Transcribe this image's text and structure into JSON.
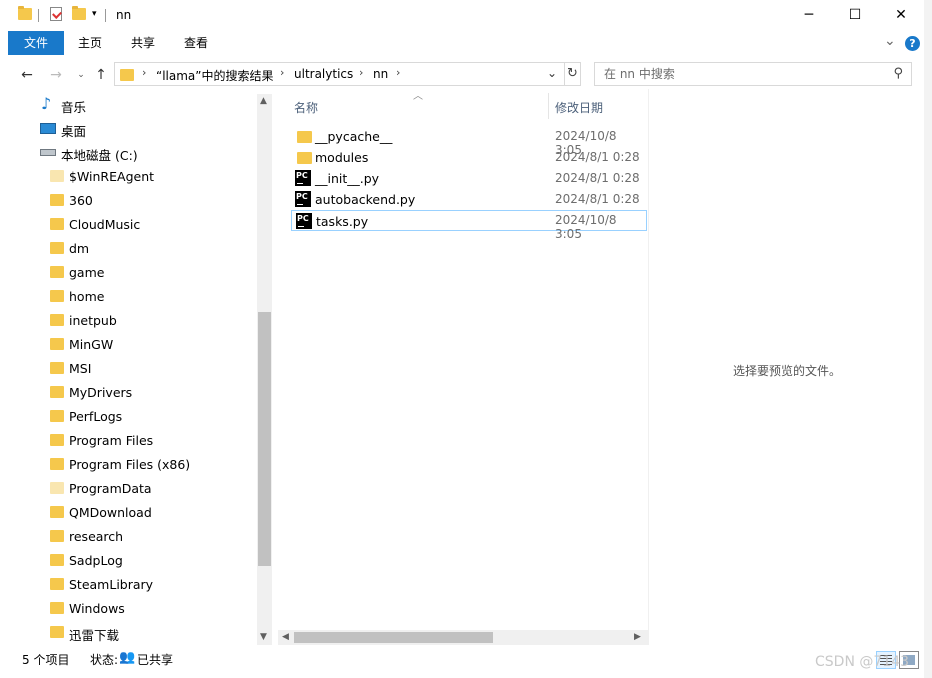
{
  "window": {
    "title": "nn",
    "minimize": "─",
    "maximize": "☐",
    "close": "✕"
  },
  "ribbon": {
    "tabs": [
      {
        "label": "文件"
      },
      {
        "label": "主页"
      },
      {
        "label": "共享"
      },
      {
        "label": "查看"
      }
    ],
    "expand": "⌄",
    "help": "?"
  },
  "address": {
    "crumbs": [
      "“llama”中的搜索结果",
      "ultralytics",
      "nn"
    ],
    "search_placeholder": "在 nn 中搜索"
  },
  "nav": {
    "items": [
      {
        "label": "音乐",
        "icon": "music-icon"
      },
      {
        "label": "桌面",
        "icon": "desktop-icon"
      },
      {
        "label": "本地磁盘 (C:)",
        "icon": "drive-icon"
      },
      {
        "label": "$WinREAgent",
        "icon": "folder-icon"
      },
      {
        "label": "360",
        "icon": "folder-icon"
      },
      {
        "label": "CloudMusic",
        "icon": "folder-icon"
      },
      {
        "label": "dm",
        "icon": "folder-icon"
      },
      {
        "label": "game",
        "icon": "folder-icon"
      },
      {
        "label": "home",
        "icon": "folder-icon"
      },
      {
        "label": "inetpub",
        "icon": "folder-icon"
      },
      {
        "label": "MinGW",
        "icon": "folder-icon"
      },
      {
        "label": "MSI",
        "icon": "folder-icon"
      },
      {
        "label": "MyDrivers",
        "icon": "folder-icon"
      },
      {
        "label": "PerfLogs",
        "icon": "folder-icon"
      },
      {
        "label": "Program Files",
        "icon": "folder-icon"
      },
      {
        "label": "Program Files (x86)",
        "icon": "folder-icon"
      },
      {
        "label": "ProgramData",
        "icon": "folder-icon"
      },
      {
        "label": "QMDownload",
        "icon": "folder-icon"
      },
      {
        "label": "research",
        "icon": "folder-icon"
      },
      {
        "label": "SadpLog",
        "icon": "folder-icon"
      },
      {
        "label": "SteamLibrary",
        "icon": "folder-icon"
      },
      {
        "label": "Windows",
        "icon": "folder-icon"
      },
      {
        "label": "迅雷下载",
        "icon": "folder-icon"
      }
    ]
  },
  "files": {
    "columns": {
      "name": "名称",
      "modified": "修改日期"
    },
    "rows": [
      {
        "name": "__pycache__",
        "modified": "2024/10/8 3:05",
        "type": "folder"
      },
      {
        "name": "modules",
        "modified": "2024/8/1 0:28",
        "type": "folder"
      },
      {
        "name": "__init__.py",
        "modified": "2024/8/1 0:28",
        "type": "py"
      },
      {
        "name": "autobackend.py",
        "modified": "2024/8/1 0:28",
        "type": "py"
      },
      {
        "name": "tasks.py",
        "modified": "2024/10/8 3:05",
        "type": "py",
        "selected": true
      }
    ]
  },
  "preview": {
    "message": "选择要预览的文件。"
  },
  "status": {
    "count": "5 个项目",
    "state_label": "状态:",
    "share": "已共享"
  },
  "watermark": "CSDN @7143",
  "colors": {
    "accent": "#1979ca",
    "folder": "#f5c84c",
    "selection_border": "#99d1ff"
  }
}
